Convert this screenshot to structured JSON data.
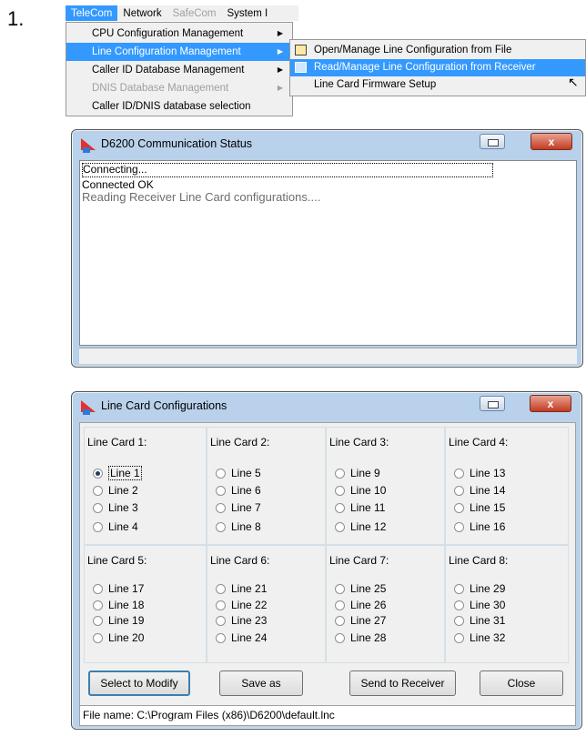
{
  "step_number": "1.",
  "menubar": {
    "items": [
      {
        "label": "TeleCom",
        "state": "active"
      },
      {
        "label": "Network",
        "state": "normal"
      },
      {
        "label": "SafeCom",
        "state": "disabled"
      },
      {
        "label": "System I",
        "state": "normal"
      }
    ]
  },
  "telecom_menu": {
    "items": [
      {
        "label": "CPU Configuration Management",
        "has_submenu": true,
        "state": "normal"
      },
      {
        "label": "Line Configuration Management",
        "has_submenu": true,
        "state": "highlighted"
      },
      {
        "label": "Caller ID Database Management",
        "has_submenu": true,
        "state": "normal"
      },
      {
        "label": "DNIS Database Management",
        "has_submenu": true,
        "state": "disabled"
      },
      {
        "label": "Caller ID/DNIS database selection",
        "has_submenu": false,
        "state": "normal"
      }
    ]
  },
  "line_config_submenu": {
    "items": [
      {
        "label": "Open/Manage Line Configuration from File",
        "icon": "open-file-icon",
        "state": "normal"
      },
      {
        "label": "Read/Manage Line Configuration from Receiver",
        "icon": "receiver-icon",
        "state": "highlighted"
      },
      {
        "label": "Line Card Firmware Setup",
        "icon": "",
        "state": "normal"
      }
    ]
  },
  "comm_window": {
    "title": "D6200 Communication Status",
    "lines": [
      "Connecting...",
      "Connected OK",
      "Reading Receiver Line Card configurations...."
    ],
    "close_glyph": "x"
  },
  "linecard_window": {
    "title": "Line Card Configurations",
    "close_glyph": "x",
    "cards": [
      {
        "title": "Line Card 1:",
        "lines": [
          "Line 1",
          "Line 2",
          "Line 3",
          "Line 4"
        ]
      },
      {
        "title": "Line Card 2:",
        "lines": [
          "Line 5",
          "Line 6",
          "Line 7",
          "Line 8"
        ]
      },
      {
        "title": "Line Card 3:",
        "lines": [
          "Line 9",
          "Line 10",
          "Line 11",
          "Line 12"
        ]
      },
      {
        "title": "Line Card 4:",
        "lines": [
          "Line 13",
          "Line 14",
          "Line 15",
          "Line 16"
        ]
      },
      {
        "title": "Line Card 5:",
        "lines": [
          "Line 17",
          "Line 18",
          "Line 19",
          "Line 20"
        ]
      },
      {
        "title": "Line Card 6:",
        "lines": [
          "Line 21",
          "Line 22",
          "Line 23",
          "Line 24"
        ]
      },
      {
        "title": "Line Card 7:",
        "lines": [
          "Line 25",
          "Line 26",
          "Line 27",
          "Line 28"
        ]
      },
      {
        "title": "Line Card 8:",
        "lines": [
          "Line 29",
          "Line 30",
          "Line 31",
          "Line 32"
        ]
      }
    ],
    "selected_line": "Line 1",
    "buttons": {
      "select_to_modify": "Select to Modify",
      "save_as": "Save as",
      "send_to_receiver": "Send to Receiver",
      "close": "Close"
    },
    "status": "File name: C:\\Program Files (x86)\\D6200\\default.lnc"
  }
}
